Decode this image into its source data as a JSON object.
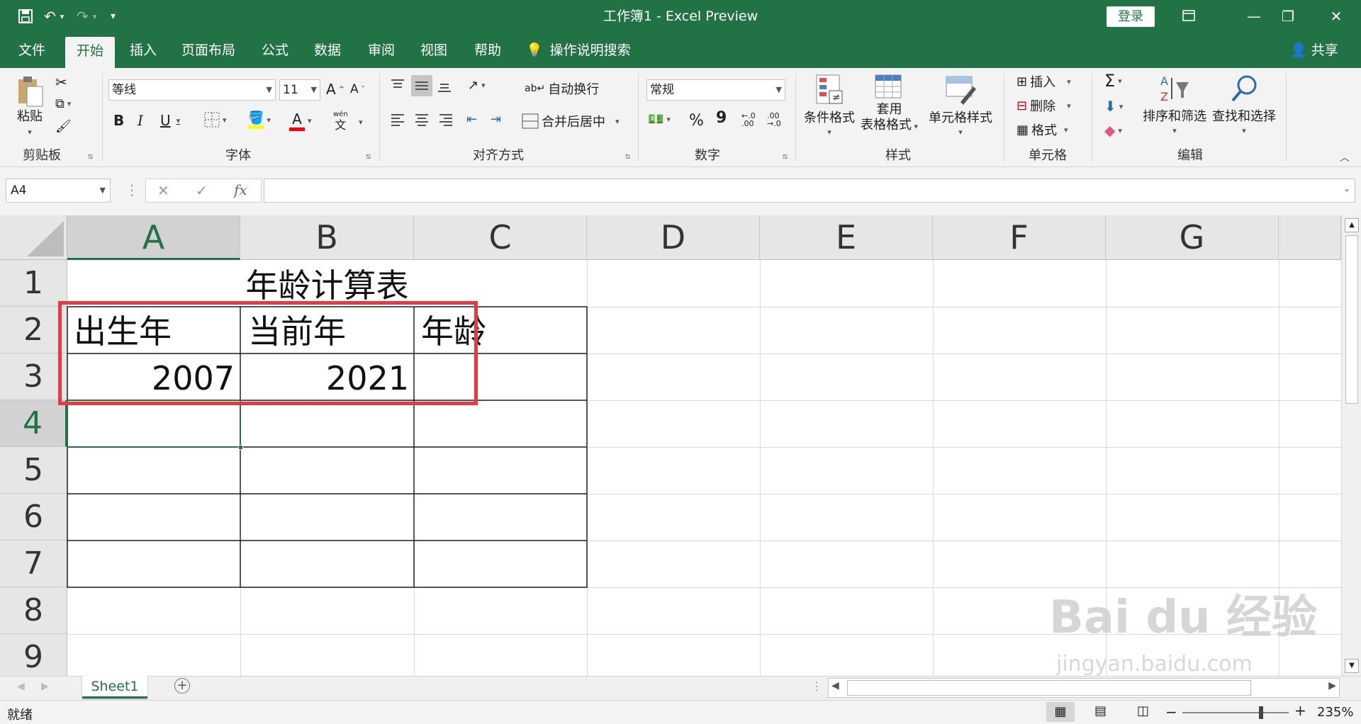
{
  "titlebar": {
    "title": "工作簿1 - Excel Preview",
    "login_label": "登录",
    "save_icon": "save-icon",
    "undo_icon": "undo-icon",
    "redo_icon": "redo-icon",
    "accent_color": "#217346"
  },
  "tabs": [
    {
      "label": "文件"
    },
    {
      "label": "开始"
    },
    {
      "label": "插入"
    },
    {
      "label": "页面布局"
    },
    {
      "label": "公式"
    },
    {
      "label": "数据"
    },
    {
      "label": "审阅"
    },
    {
      "label": "视图"
    },
    {
      "label": "帮助"
    }
  ],
  "tell_me": "操作说明搜索",
  "share_label": "共享",
  "ribbon": {
    "clipboard": {
      "paste": "粘贴",
      "group": "剪贴板"
    },
    "font": {
      "name": "等线",
      "size": "11",
      "group": "字体",
      "bold": "B",
      "italic": "I",
      "underline": "U",
      "pinyin": "wén"
    },
    "alignment": {
      "wrap": "自动换行",
      "merge": "合并后居中",
      "group": "对齐方式"
    },
    "number": {
      "format": "常规",
      "percent": "%",
      "comma": "9",
      "group": "数字"
    },
    "styles": {
      "conditional": "条件格式",
      "table_line1": "套用",
      "table_line2": "表格格式",
      "cell_styles": "单元格样式",
      "group": "样式"
    },
    "cells": {
      "insert": "插入",
      "delete": "删除",
      "format": "格式",
      "group": "单元格"
    },
    "editing": {
      "sort": "排序和筛选",
      "find": "查找和选择",
      "group": "编辑"
    }
  },
  "formula_bar": {
    "name_box": "A4",
    "fx": "fx",
    "formula": ""
  },
  "columns": [
    "A",
    "B",
    "C",
    "D",
    "E",
    "F",
    "G"
  ],
  "rows": [
    "1",
    "2",
    "3",
    "4",
    "5",
    "6",
    "7",
    "8",
    "9"
  ],
  "cells": {
    "title": "年龄计算表",
    "a2": "出生年",
    "b2": "当前年",
    "c2": "年龄",
    "a3": "2007",
    "b3": "2021"
  },
  "sheet_tab": "Sheet1",
  "status": {
    "ready": "就绪",
    "zoom": "235%"
  },
  "watermark": {
    "brand": "Bai du 经验",
    "url": "jingyan.baidu.com"
  }
}
